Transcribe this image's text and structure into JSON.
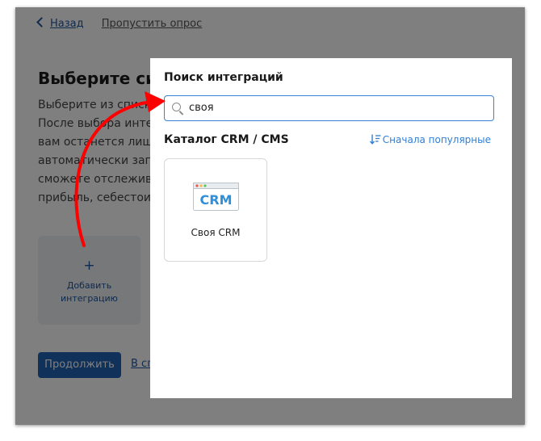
{
  "background": {
    "nav": {
      "back_label": "Назад",
      "skip_label": "Пропустить опрос"
    },
    "title": "Выберите сис",
    "description_lines": [
      "Выберите из списка",
      "После выбора интег",
      "вам останется лишь",
      "автоматически загру",
      "сможете отслеживат",
      "прибыль, себестоим"
    ],
    "add_card": {
      "plus": "+",
      "label_line1": "Добавить",
      "label_line2": "интеграцию"
    },
    "continue_label": "Продолжить",
    "link_partial": "В сп"
  },
  "modal": {
    "title": "Поиск интеграций",
    "search": {
      "value": "своя",
      "icon": "search-icon"
    },
    "catalog_title": "Каталог CRM / CMS",
    "sort_label": "Сначала популярные",
    "sort_icon": "sort-descending-icon",
    "items": [
      {
        "label": "Своя CRM",
        "logo_text": "CRM"
      }
    ]
  },
  "annotation": {
    "arrow_color": "#ff0000"
  },
  "colors": {
    "accent": "#1e62b5",
    "link": "#2f7fd6",
    "search_border": "#3b82d6"
  }
}
